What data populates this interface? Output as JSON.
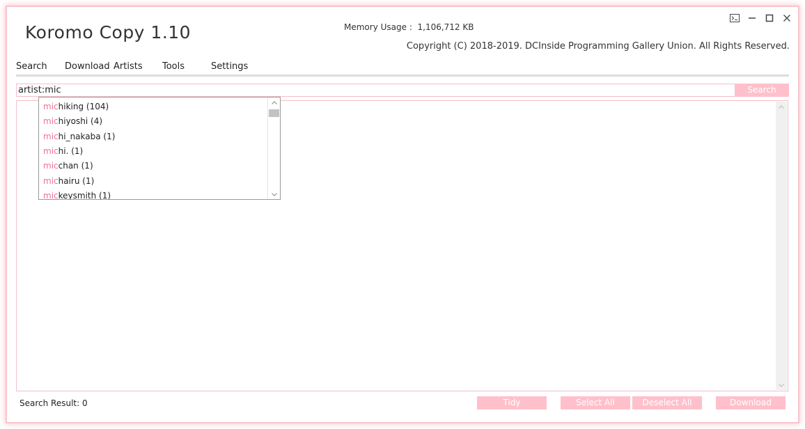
{
  "app": {
    "title": "Koromo Copy 1.10",
    "memory_usage": "Memory Usage :  1,106,712 KB",
    "copyright": "Copyright (C) 2018-2019. DCInside Programming Gallery Union. All Rights Reserved."
  },
  "window_controls": {
    "console_icon": "console-icon",
    "minimize_icon": "minimize-icon",
    "maximize_icon": "maximize-icon",
    "close_icon": "close-icon"
  },
  "tabs": [
    {
      "label": "Search"
    },
    {
      "label": "Download"
    },
    {
      "label": "Artists"
    },
    {
      "label": "Tools"
    },
    {
      "label": "Settings"
    }
  ],
  "search": {
    "value": "artist:mic",
    "button_label": "Search"
  },
  "suggestions": [
    {
      "match": "mic",
      "rest": "hiking",
      "count": "(104)"
    },
    {
      "match": "mic",
      "rest": "hiyoshi",
      "count": "(4)"
    },
    {
      "match": "mic",
      "rest": "hi_nakaba",
      "count": "(1)"
    },
    {
      "match": "mic",
      "rest": "hi.",
      "count": "(1)"
    },
    {
      "match": "mic",
      "rest": "chan",
      "count": "(1)"
    },
    {
      "match": "mic",
      "rest": "hairu",
      "count": "(1)"
    },
    {
      "match": "mic",
      "rest": "keysmith",
      "count": "(1)"
    }
  ],
  "footer": {
    "status": "Search Result: 0",
    "tidy_label": "Tidy",
    "select_all_label": "Select All",
    "deselect_all_label": "Deselect All",
    "download_label": "Download"
  },
  "colors": {
    "accent": "#ffc0cb",
    "highlight": "#ee6f98",
    "border": "#f2bfc8"
  }
}
